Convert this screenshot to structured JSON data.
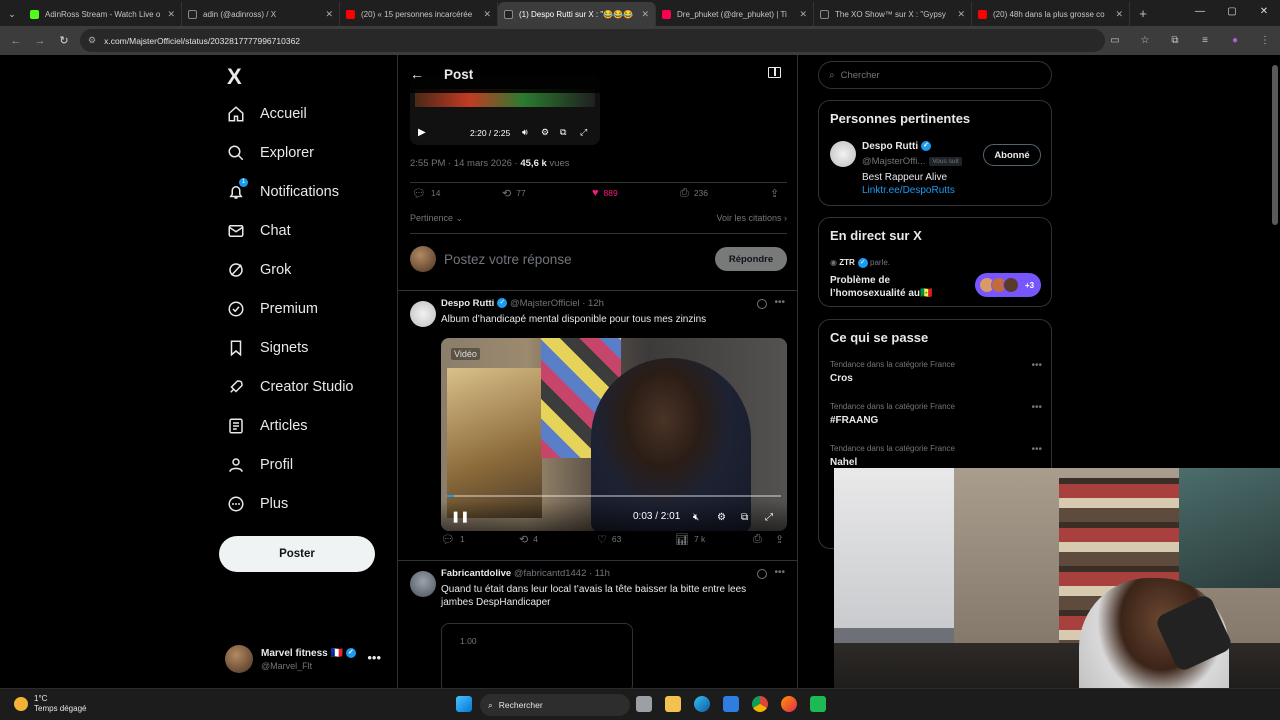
{
  "browser": {
    "tabs": [
      {
        "title": "AdinRoss Stream - Watch Live o",
        "color": "#53fc18",
        "active": false
      },
      {
        "title": "adin (@adinross) / X",
        "color": "#e7e9ea",
        "active": false
      },
      {
        "title": "(20) « 15 personnes incarcérée",
        "color": "#ff0000",
        "active": false
      },
      {
        "title": "(1) Despo Rutti sur X : \"😂😂😂",
        "color": "#e7e9ea",
        "active": true
      },
      {
        "title": "Dre_phuket (@dre_phuket) | Ti",
        "color": "#ff0050",
        "active": false
      },
      {
        "title": "The XO Show™ sur X : \"Gypsy",
        "color": "#e7e9ea",
        "active": false
      },
      {
        "title": "(20) 48h dans la plus grosse co",
        "color": "#ff0000",
        "active": false
      }
    ],
    "url": "x.com/MajsterOfficiel/status/2032817777996710362"
  },
  "nav": {
    "logo": "X",
    "items": [
      {
        "label": "Accueil",
        "icon": "home-icon"
      },
      {
        "label": "Explorer",
        "icon": "search-icon"
      },
      {
        "label": "Notifications",
        "icon": "bell-icon",
        "badge": "1"
      },
      {
        "label": "Chat",
        "icon": "mail-icon"
      },
      {
        "label": "Grok",
        "icon": "grok-icon"
      },
      {
        "label": "Premium",
        "icon": "premium-icon"
      },
      {
        "label": "Signets",
        "icon": "bookmark-icon"
      },
      {
        "label": "Creator Studio",
        "icon": "rocket-icon"
      },
      {
        "label": "Articles",
        "icon": "article-icon"
      },
      {
        "label": "Profil",
        "icon": "person-icon"
      },
      {
        "label": "Plus",
        "icon": "more-circle-icon"
      }
    ],
    "post_button": "Poster",
    "account": {
      "name": "Marvel fitness 🇫🇷",
      "handle": "@Marvel_Flt"
    }
  },
  "post": {
    "header_title": "Post",
    "video_time": "2:20 / 2:25",
    "timestamp": "2:55 PM · 14 mars 2026 · ",
    "views_count": "45,6 k",
    "views_label": " vues",
    "stats": {
      "replies": "14",
      "reposts": "77",
      "likes": "889",
      "bookmarks": "236"
    },
    "sort_label": "Pertinence ⌄",
    "quotes_label": "Voir les citations ›",
    "reply_placeholder": "Postez votre réponse",
    "reply_button": "Répondre"
  },
  "replies": [
    {
      "name": "Despo Rutti",
      "handle": "@MajsterOfficiel · 12h",
      "text": "Album d’handicapé mental disponible pour tous mes zinzins",
      "video_caption": "Vidéo",
      "video_time": "0:03 / 2:01",
      "video_progress": 0.02,
      "stats": {
        "replies": "1",
        "reposts": "4",
        "likes": "63",
        "views": "7 k"
      }
    },
    {
      "name": "Fabricantdolive",
      "handle": "@fabricantd1442 · 11h",
      "text": "Quand tu était dans leur local t’avais la tête baisser la bitte entre lees jambes DespHandicaper",
      "embed_value": "1.00"
    }
  ],
  "right": {
    "search_placeholder": "Chercher",
    "relevant": {
      "title": "Personnes pertinentes",
      "name": "Despo Rutti",
      "handle": "@MajsterOffi...",
      "follows_you": "Vous suit",
      "bio": "Best Rappeur Alive",
      "link": "Linktr.ee/DespoRutts",
      "button": "Abonné"
    },
    "live": {
      "title": "En direct sur X",
      "host": "ZTR",
      "host_suffix": " parle.",
      "topic": "Problème de l’homosexualité au🇸🇳",
      "extra_count": "+3"
    },
    "trends": {
      "title": "Ce qui se passe",
      "items": [
        {
          "category": "Tendance dans la catégorie France",
          "name": "Cros"
        },
        {
          "category": "Tendance dans la catégorie France",
          "name": "#FRAANG"
        },
        {
          "category": "Tendance dans la catégorie France",
          "name": "Nahel"
        }
      ]
    }
  },
  "taskbar": {
    "temp": "1°C",
    "weather": "Temps dégagé",
    "search": "Rechercher"
  }
}
